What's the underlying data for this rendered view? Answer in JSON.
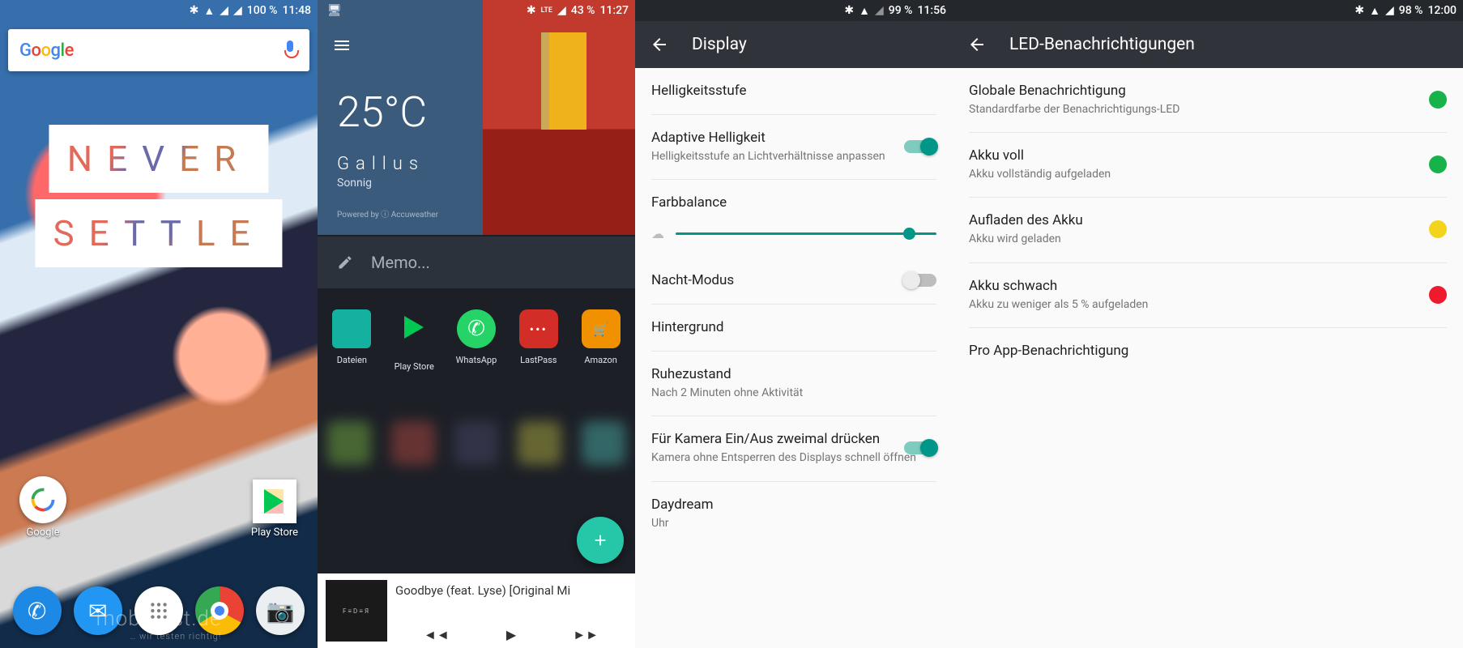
{
  "pane1": {
    "status": {
      "battery": "100 %",
      "time": "11:48"
    },
    "search_placeholder": "Google",
    "wallpaper_text_line1": "NEVER",
    "wallpaper_text_line2": "SETTLE",
    "folder_google": "Google",
    "icon_play": "Play Store",
    "watermark": "mobi-test.de",
    "watermark_sub": "… wir testen richtig!"
  },
  "pane2": {
    "status": {
      "network": "LTE",
      "battery": "43 %",
      "time": "11:27"
    },
    "temp": "25°C",
    "location": "Gallus",
    "condition": "Sonnig",
    "attribution": "Powered by ⓘ Accuweather",
    "memo_placeholder": "Memo...",
    "apps": [
      {
        "label": "Dateien",
        "color": "#14b1a1"
      },
      {
        "label": "Play Store",
        "color": "#ffffff"
      },
      {
        "label": "WhatsApp",
        "color": "#25d366"
      },
      {
        "label": "LastPass",
        "color": "#d32d27"
      },
      {
        "label": "Amazon",
        "color": "#f29100"
      }
    ],
    "now_playing": "Goodbye (feat. Lyse) [Original Mi"
  },
  "pane3": {
    "status": {
      "battery": "99 %",
      "time": "11:56"
    },
    "title": "Display",
    "items": [
      {
        "title": "Helligkeitsstufe"
      },
      {
        "title": "Adaptive Helligkeit",
        "sub": "Helligkeitsstufe an Lichtverhältnisse anpassen",
        "switch": "on"
      },
      {
        "title": "Farbbalance",
        "slider": true
      },
      {
        "title": "Nacht-Modus",
        "switch": "off"
      },
      {
        "title": "Hintergrund"
      },
      {
        "title": "Ruhezustand",
        "sub": "Nach 2 Minuten ohne Aktivität"
      },
      {
        "title": "Für Kamera Ein/Aus zweimal drücken",
        "sub": "Kamera ohne Entsperren des Displays schnell öffnen",
        "switch": "on"
      },
      {
        "title": "Daydream",
        "sub": "Uhr"
      }
    ]
  },
  "pane4": {
    "status": {
      "battery": "98 %",
      "time": "12:00"
    },
    "title": "LED-Benachrichtigungen",
    "items": [
      {
        "title": "Globale Benachrichtigung",
        "sub": "Standardfarbe der Benachrichtigungs-LED",
        "dot": "#18b24b"
      },
      {
        "title": "Akku voll",
        "sub": "Akku vollständig aufgeladen",
        "dot": "#18b24b"
      },
      {
        "title": "Aufladen des Akku",
        "sub": "Akku wird geladen",
        "dot": "#f2d41c"
      },
      {
        "title": "Akku schwach",
        "sub": "Akku zu weniger als 5 % aufgeladen",
        "dot": "#ef1a2e"
      },
      {
        "title": "Pro App-Benachrichtigung"
      }
    ]
  }
}
